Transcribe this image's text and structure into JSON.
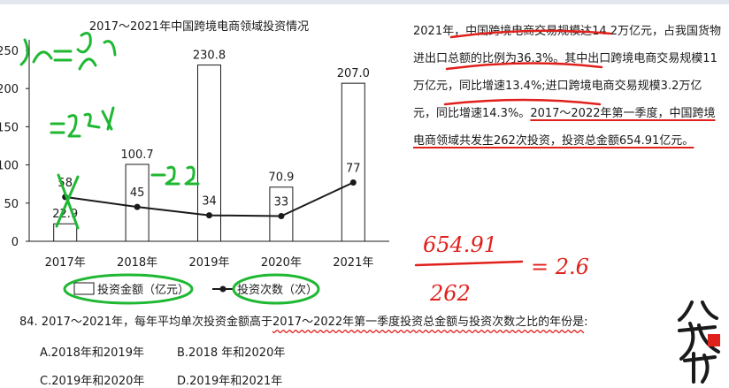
{
  "chart_data": {
    "type": "bar",
    "title": "2017～2021年中国跨境电商领域投资情况",
    "categories": [
      "2017年",
      "2018年",
      "2019年",
      "2020年",
      "2021年"
    ],
    "y_ticks": [
      "0",
      "50",
      "100",
      "150",
      "200",
      "250"
    ],
    "ylim": [
      0,
      250
    ],
    "series": [
      {
        "name": "投资金额（亿元）",
        "type": "bar",
        "values": [
          22.9,
          100.7,
          230.8,
          70.9,
          207.0
        ],
        "labels": [
          "22.9",
          "100.7",
          "230.8",
          "70.9",
          "207.0"
        ]
      },
      {
        "name": "投资次数（次）",
        "type": "line",
        "values": [
          58,
          45,
          34,
          33,
          77
        ],
        "labels": [
          "58",
          "45",
          "34",
          "33",
          "77"
        ]
      }
    ],
    "legend_placement": "bottom",
    "grid": false
  },
  "passage": {
    "p1": "2021年，中国跨境电商交易规模达14.2万亿元，占我国货物进出口总额的比例为36.3%。其中出口跨境电商交易规模11万亿元，同比增速13.4%;进口跨境电商交易规模3.2万亿元，同比增速14.3%。",
    "highlight": "2017～2022年第一季度，中国跨境电商领域共发生262次投资，投资总金额654.91亿元。"
  },
  "question": {
    "prefix": "84. 2017～2021年，每年平均单次投资金额高于",
    "highlight": "2017～2022年第一季度投资总金额与投资次数之比的年份是",
    "suffix": ":"
  },
  "options": {
    "a": "A.2018年和2019年",
    "b": "B.2018 年和2020年",
    "c": "C.2019年和2020年",
    "d": "D.2019年和2021年"
  },
  "handwriting": {
    "h1": "%=90 22",
    "h2": "=22.%",
    "h3": "-22",
    "h4": "654.91",
    "h5": "262",
    "h6": "= 2.6"
  },
  "colors": {
    "ink_red": "#e0201b",
    "ink_green": "#1fb832",
    "line": "#1a1a1a",
    "bar_fill": "#ffffff"
  }
}
